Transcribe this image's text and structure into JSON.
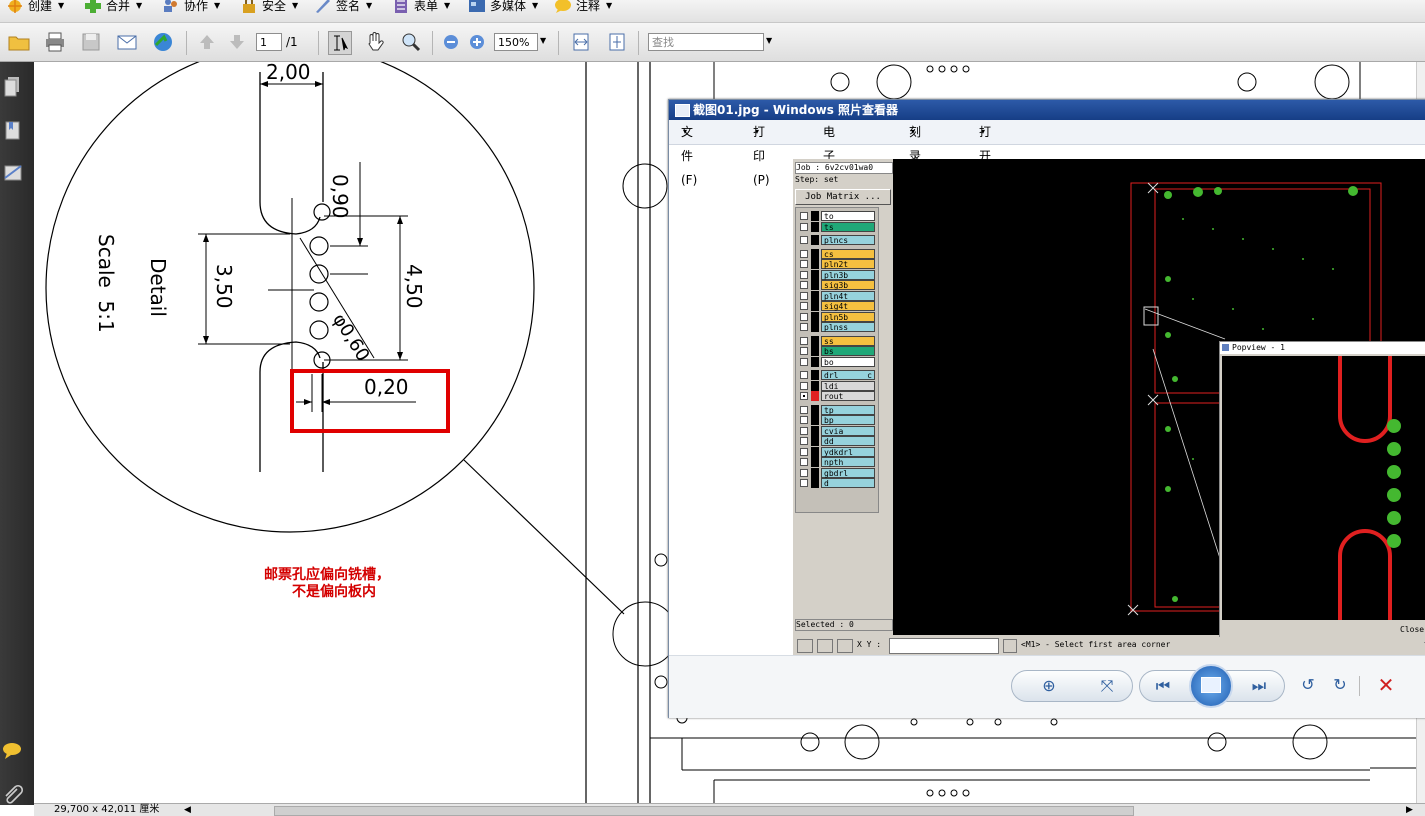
{
  "menu": [
    {
      "label": "创建",
      "icon": "create-icon"
    },
    {
      "label": "合并",
      "icon": "combine-icon"
    },
    {
      "label": "协作",
      "icon": "collaborate-icon"
    },
    {
      "label": "安全",
      "icon": "lock-icon"
    },
    {
      "label": "签名",
      "icon": "sign-pen-icon"
    },
    {
      "label": "表单",
      "icon": "form-icon"
    },
    {
      "label": "多媒体",
      "icon": "multimedia-icon"
    },
    {
      "label": "注释",
      "icon": "comment-icon"
    }
  ],
  "toolbar": {
    "page_current": "1",
    "page_total": "/1",
    "zoom": "150%",
    "search_placeholder": "查找"
  },
  "drawing": {
    "detail_label": "Detail",
    "scale_label": "Scale  5:1",
    "dims": {
      "d200": "2,00",
      "d090": "0,90",
      "d350": "3,50",
      "d450": "4,50",
      "d060": "φ0,60",
      "d020": "0,20"
    },
    "note_line1": "邮票孔应偏向铣槽，",
    "note_line2": "不是偏向板内"
  },
  "statusbar": {
    "page_size": "29,700 x 42,011 厘米"
  },
  "viewer": {
    "title": "截图01.jpg - Windows 照片查看器",
    "menu": [
      "文件(F)",
      "打印(P)",
      "电子邮件(E)",
      "刻录(U)",
      "打开(O)"
    ],
    "cam": {
      "job": "Job : 6v2cv01wa0",
      "step": "Step: set",
      "matrix_button": "Job Matrix ...",
      "selected": "Selected : 0",
      "xy_label": "X Y :",
      "prompt": "<M1> - Select first area corner",
      "layers": [
        {
          "name": "to",
          "color": "#ffffff",
          "checked": false
        },
        {
          "name": "ts",
          "color": "#20a878",
          "checked": false
        },
        {
          "name": "plncs",
          "color": "#96d2dc",
          "checked": false
        },
        {
          "name": "cs",
          "color": "#f5c040",
          "checked": false
        },
        {
          "name": "pln2t",
          "color": "#f5c040",
          "checked": false
        },
        {
          "name": "pln3b",
          "color": "#96d2dc",
          "checked": false
        },
        {
          "name": "sig3b",
          "color": "#f5c040",
          "checked": false
        },
        {
          "name": "pln4t",
          "color": "#96d2dc",
          "checked": false
        },
        {
          "name": "sig4t",
          "color": "#f5c040",
          "checked": false
        },
        {
          "name": "pln5b",
          "color": "#f5c040",
          "checked": false
        },
        {
          "name": "plnss",
          "color": "#96d2dc",
          "checked": false
        },
        {
          "name": "ss",
          "color": "#f5c040",
          "checked": false
        },
        {
          "name": "bs",
          "color": "#20a878",
          "checked": false
        },
        {
          "name": "bo",
          "color": "#ffffff",
          "checked": false
        },
        {
          "name": "drl",
          "color": "#96d2dc",
          "checked": false
        },
        {
          "name": "ldi",
          "color": "#d8d8d8",
          "checked": false
        },
        {
          "name": "rout",
          "color": "#d8d8d8",
          "checked": true
        },
        {
          "name": "tp",
          "color": "#96d2dc",
          "checked": false
        },
        {
          "name": "bp",
          "color": "#96d2dc",
          "checked": false
        },
        {
          "name": "cvia",
          "color": "#96d2dc",
          "checked": false
        },
        {
          "name": "dd",
          "color": "#96d2dc",
          "checked": false
        },
        {
          "name": "ydkdrl",
          "color": "#96d2dc",
          "checked": false
        },
        {
          "name": "npth",
          "color": "#96d2dc",
          "checked": false
        },
        {
          "name": "gbdrl",
          "color": "#96d2dc",
          "checked": false
        },
        {
          "name": "d",
          "color": "#96d2dc",
          "checked": false
        }
      ],
      "drl_suffix": "c",
      "popview_title": "Popview - 1",
      "popview_close": "Close"
    }
  },
  "colors": {
    "highlight_box": "#e00000",
    "note_text": "#d40000",
    "cam_background": "#000000",
    "rout_line": "#e02020",
    "pad_green": "#44b830"
  }
}
